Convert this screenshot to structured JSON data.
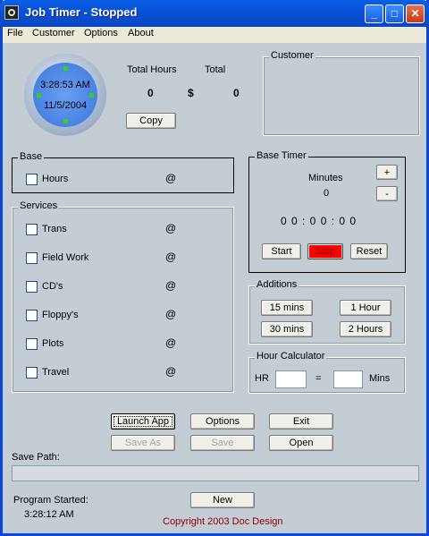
{
  "window": {
    "title": "Job Timer - Stopped"
  },
  "titlebar_buttons": {
    "minimize": "_",
    "maximize": "□",
    "close": "✕"
  },
  "menu": [
    "File",
    "Customer",
    "Options",
    "About"
  ],
  "clock": {
    "time": "3:28:53 AM",
    "date": "11/5/2004"
  },
  "totals": {
    "hours_label": "Total Hours",
    "total_label": "Total",
    "hours_value": "0",
    "currency": "$",
    "total_value": "0",
    "copy_label": "Copy"
  },
  "customer": {
    "label": "Customer"
  },
  "base": {
    "label": "Base",
    "item": "Hours",
    "at": "@"
  },
  "services": {
    "label": "Services",
    "items": [
      "Trans",
      "Field Work",
      "CD's",
      "Floppy's",
      "Plots",
      "Travel"
    ],
    "at": "@"
  },
  "base_timer": {
    "label": "Base Timer",
    "minutes_label": "Minutes",
    "minutes_value": "0",
    "plus": "+",
    "minus": "-",
    "display": "0 0 : 0 0 : 0 0",
    "start": "Start",
    "stop": "Stop",
    "reset": "Reset",
    "stop_color": "#ff0000"
  },
  "additions": {
    "label": "Additions",
    "b15": "15 mins",
    "b1h": "1 Hour",
    "b30": "30 mins",
    "b2h": "2 Hours"
  },
  "hour_calc": {
    "label": "Hour Calculator",
    "hr": "HR",
    "eq": "=",
    "mins": "Mins"
  },
  "actions": {
    "launch": "Launch App",
    "options": "Options",
    "exit": "Exit",
    "save_as": "Save As",
    "save": "Save",
    "open": "Open",
    "new": "New"
  },
  "save_path": {
    "label": "Save Path:"
  },
  "program": {
    "label": "Program Started:",
    "time": "3:28:12 AM"
  },
  "copyright": "Copyright 2003 Doc Design",
  "colors": {
    "title": "#0a52d6",
    "client": "#c4ccd4",
    "copyright": "#8b0000"
  }
}
